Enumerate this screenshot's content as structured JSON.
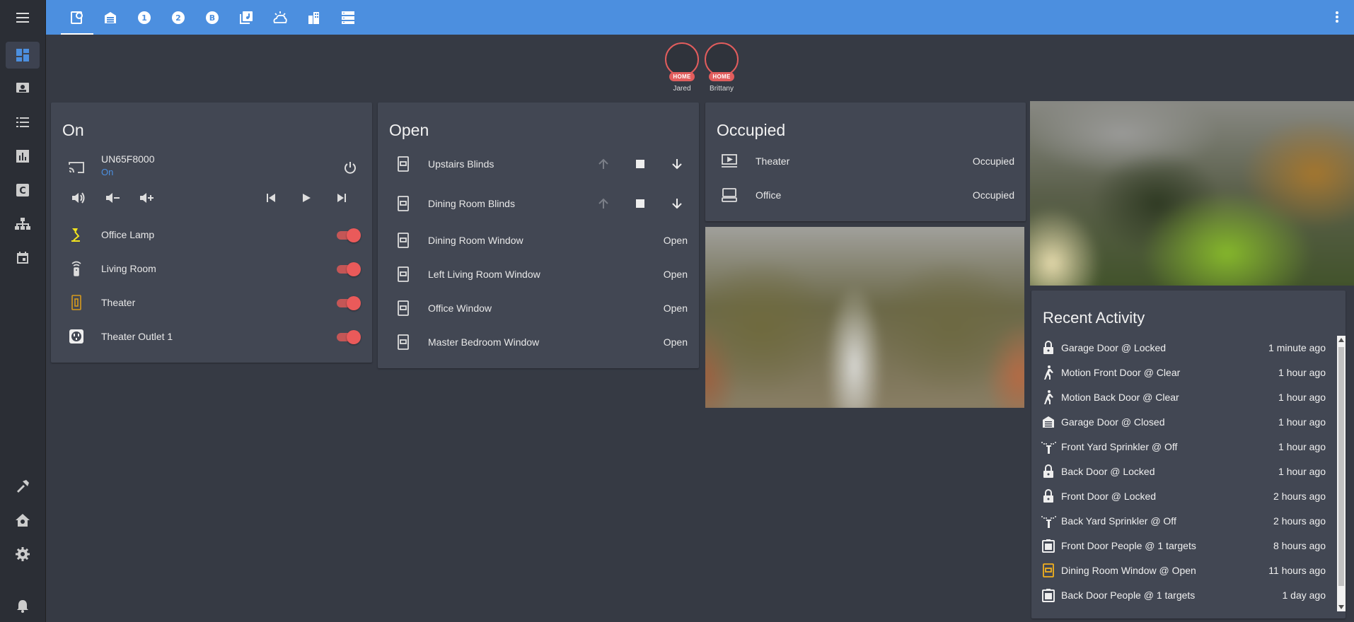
{
  "sidebar": {
    "icons": [
      "menu-icon",
      "overview-icon",
      "map-icon",
      "logbook-icon",
      "history-icon",
      "hacs-icon",
      "network-icon",
      "calendar-icon",
      "developer-tools-icon",
      "supervisor-icon",
      "settings-icon",
      "notifications-icon"
    ]
  },
  "topbar": {
    "tabs": [
      "home-tab",
      "garage-tab",
      "floor-1-tab",
      "floor-2-tab",
      "basement-tab",
      "media-tab",
      "weather-tab",
      "city-tab",
      "server-tab"
    ],
    "accent": "#4c8fdf"
  },
  "badges": [
    {
      "name": "Jared",
      "state": "HOME"
    },
    {
      "name": "Brittany",
      "state": "HOME"
    }
  ],
  "on_card": {
    "title": "On",
    "media": {
      "name": "UN65F8000",
      "state": "On"
    },
    "switches": [
      {
        "name": "Office Lamp",
        "icon": "lamp-icon"
      },
      {
        "name": "Living Room",
        "icon": "remote-icon"
      },
      {
        "name": "Theater",
        "icon": "light-switch-icon"
      },
      {
        "name": "Theater Outlet 1",
        "icon": "power-socket-icon"
      }
    ]
  },
  "open_card": {
    "title": "Open",
    "covers": [
      {
        "name": "Upstairs Blinds"
      },
      {
        "name": "Dining Room Blinds"
      }
    ],
    "windows": [
      {
        "name": "Dining Room Window",
        "state": "Open"
      },
      {
        "name": "Left Living Room Window",
        "state": "Open"
      },
      {
        "name": "Office Window",
        "state": "Open"
      },
      {
        "name": "Master Bedroom Window",
        "state": "Open"
      }
    ]
  },
  "occupied_card": {
    "title": "Occupied",
    "rooms": [
      {
        "name": "Theater",
        "state": "Occupied",
        "icon": "theater-icon"
      },
      {
        "name": "Office",
        "state": "Occupied",
        "icon": "desktop-icon"
      }
    ]
  },
  "activity_card": {
    "title": "Recent Activity",
    "items": [
      {
        "text": "Garage Door @ Locked",
        "time": "1 minute ago",
        "icon": "lock-icon"
      },
      {
        "text": "Motion Front Door @ Clear",
        "time": "1 hour ago",
        "icon": "walk-icon"
      },
      {
        "text": "Motion Back Door @ Clear",
        "time": "1 hour ago",
        "icon": "walk-icon"
      },
      {
        "text": "Garage Door @ Closed",
        "time": "1 hour ago",
        "icon": "garage-icon"
      },
      {
        "text": "Front Yard Sprinkler @ Off",
        "time": "1 hour ago",
        "icon": "sprinkler-icon"
      },
      {
        "text": "Back Door @ Locked",
        "time": "1 hour ago",
        "icon": "lock-icon"
      },
      {
        "text": "Front Door @ Locked",
        "time": "2 hours ago",
        "icon": "lock-icon"
      },
      {
        "text": "Back Yard Sprinkler @ Off",
        "time": "2 hours ago",
        "icon": "sprinkler-icon"
      },
      {
        "text": "Front Door People @ 1 targets",
        "time": "8 hours ago",
        "icon": "account-box-icon"
      },
      {
        "text": "Dining Room Window @ Open",
        "time": "11 hours ago",
        "icon": "window-icon"
      },
      {
        "text": "Back Door People @ 1 targets",
        "time": "1 day ago",
        "icon": "account-box-icon"
      }
    ]
  },
  "colors": {
    "toggle_on": "#ea5a5a",
    "badge": "#e25d5d",
    "media_state": "#4c8fdf",
    "window_highlight": "#f2b01e"
  }
}
